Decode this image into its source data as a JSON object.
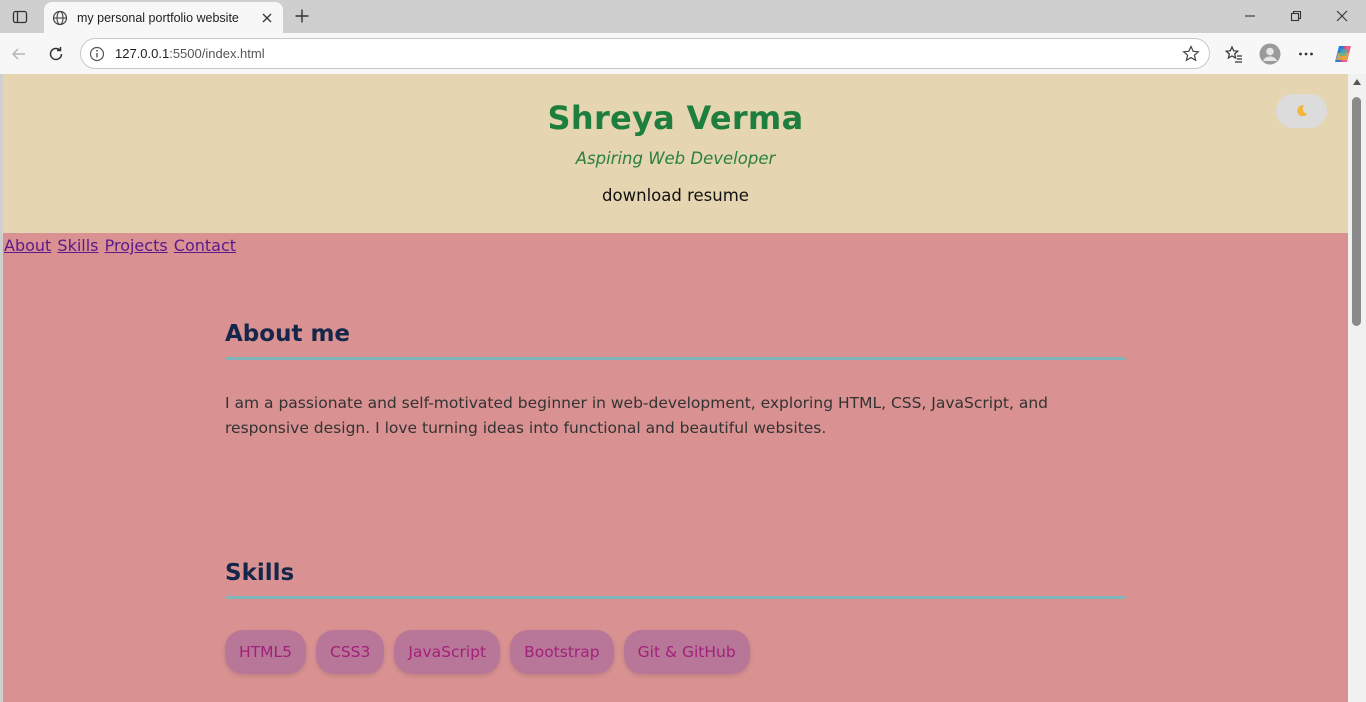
{
  "browser": {
    "tab_title": "my personal portfolio website",
    "url_host": "127.0.0.1",
    "url_path": ":5500/index.html"
  },
  "header": {
    "name": "Shreya Verma",
    "tagline": "Aspiring Web Developer",
    "resume_link": "download resume",
    "theme_toggle_icon": "moon-icon"
  },
  "nav": {
    "items": [
      {
        "label": "About"
      },
      {
        "label": "Skills"
      },
      {
        "label": "Projects"
      },
      {
        "label": "Contact"
      }
    ]
  },
  "about": {
    "heading": "About me",
    "text": "I am a passionate and self-motivated beginner in web-development, exploring HTML, CSS, JavaScript, and responsive design. I love turning ideas into functional and beautiful websites."
  },
  "skills": {
    "heading": "Skills",
    "items": [
      {
        "label": "HTML5"
      },
      {
        "label": "CSS3"
      },
      {
        "label": "JavaScript"
      },
      {
        "label": "Bootstrap"
      },
      {
        "label": "Git & GitHub"
      }
    ]
  },
  "colors": {
    "header_bg": "#e5d5b0",
    "page_bg": "#d99191",
    "name_color": "#1e7e3e",
    "heading_color": "#14274a",
    "divider_color": "#7fb5b9",
    "chip_bg": "#b87798",
    "chip_text": "#a21f7a"
  }
}
